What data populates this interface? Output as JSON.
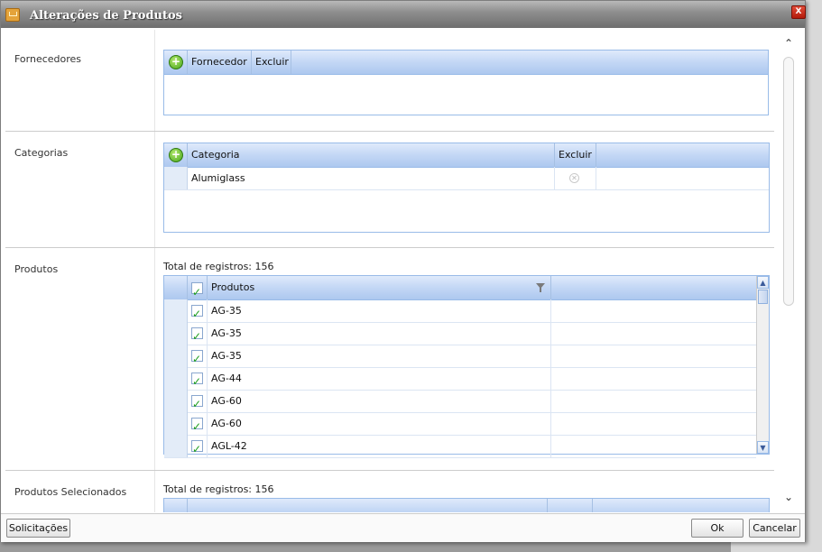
{
  "window": {
    "title": "Alterações de Produtos",
    "close_label": "X"
  },
  "sections": {
    "fornecedores": {
      "label": "Fornecedores",
      "add_label": "+",
      "columns": [
        "Fornecedor",
        "Excluir"
      ],
      "rows": []
    },
    "categorias": {
      "label": "Categorias",
      "add_label": "+",
      "columns": [
        "Categoria",
        "Excluir"
      ],
      "rows": [
        {
          "categoria": "Alumiglass",
          "excluir_icon": "remove-icon",
          "excluir_glyph": "✕"
        }
      ]
    },
    "produtos": {
      "label": "Produtos",
      "total_text": "Total de registros: 156",
      "column": "Produtos",
      "all_checked": true,
      "rows": [
        {
          "name": "AG-35",
          "checked": true
        },
        {
          "name": "AG-35",
          "checked": true
        },
        {
          "name": "AG-35",
          "checked": true
        },
        {
          "name": "AG-44",
          "checked": true
        },
        {
          "name": "AG-60",
          "checked": true
        },
        {
          "name": "AG-60",
          "checked": true
        },
        {
          "name": "AGL-42",
          "checked": true
        }
      ],
      "scroll_up": "▲",
      "scroll_down": "▼"
    },
    "produtos_selecionados": {
      "label": "Produtos Selecionados",
      "total_text": "Total de registros: 156"
    }
  },
  "outer_scroll": {
    "up": "⌃",
    "down": "⌄"
  },
  "footer": {
    "solicitacoes": "Solicitações",
    "ok": "Ok",
    "cancelar": "Cancelar"
  },
  "colors": {
    "grid_header": "#c3d7f5",
    "grid_border": "#99bbe8",
    "add_icon": "#44a31a",
    "check": "#1a9c1a",
    "title_bar": "#8f8f8f"
  }
}
